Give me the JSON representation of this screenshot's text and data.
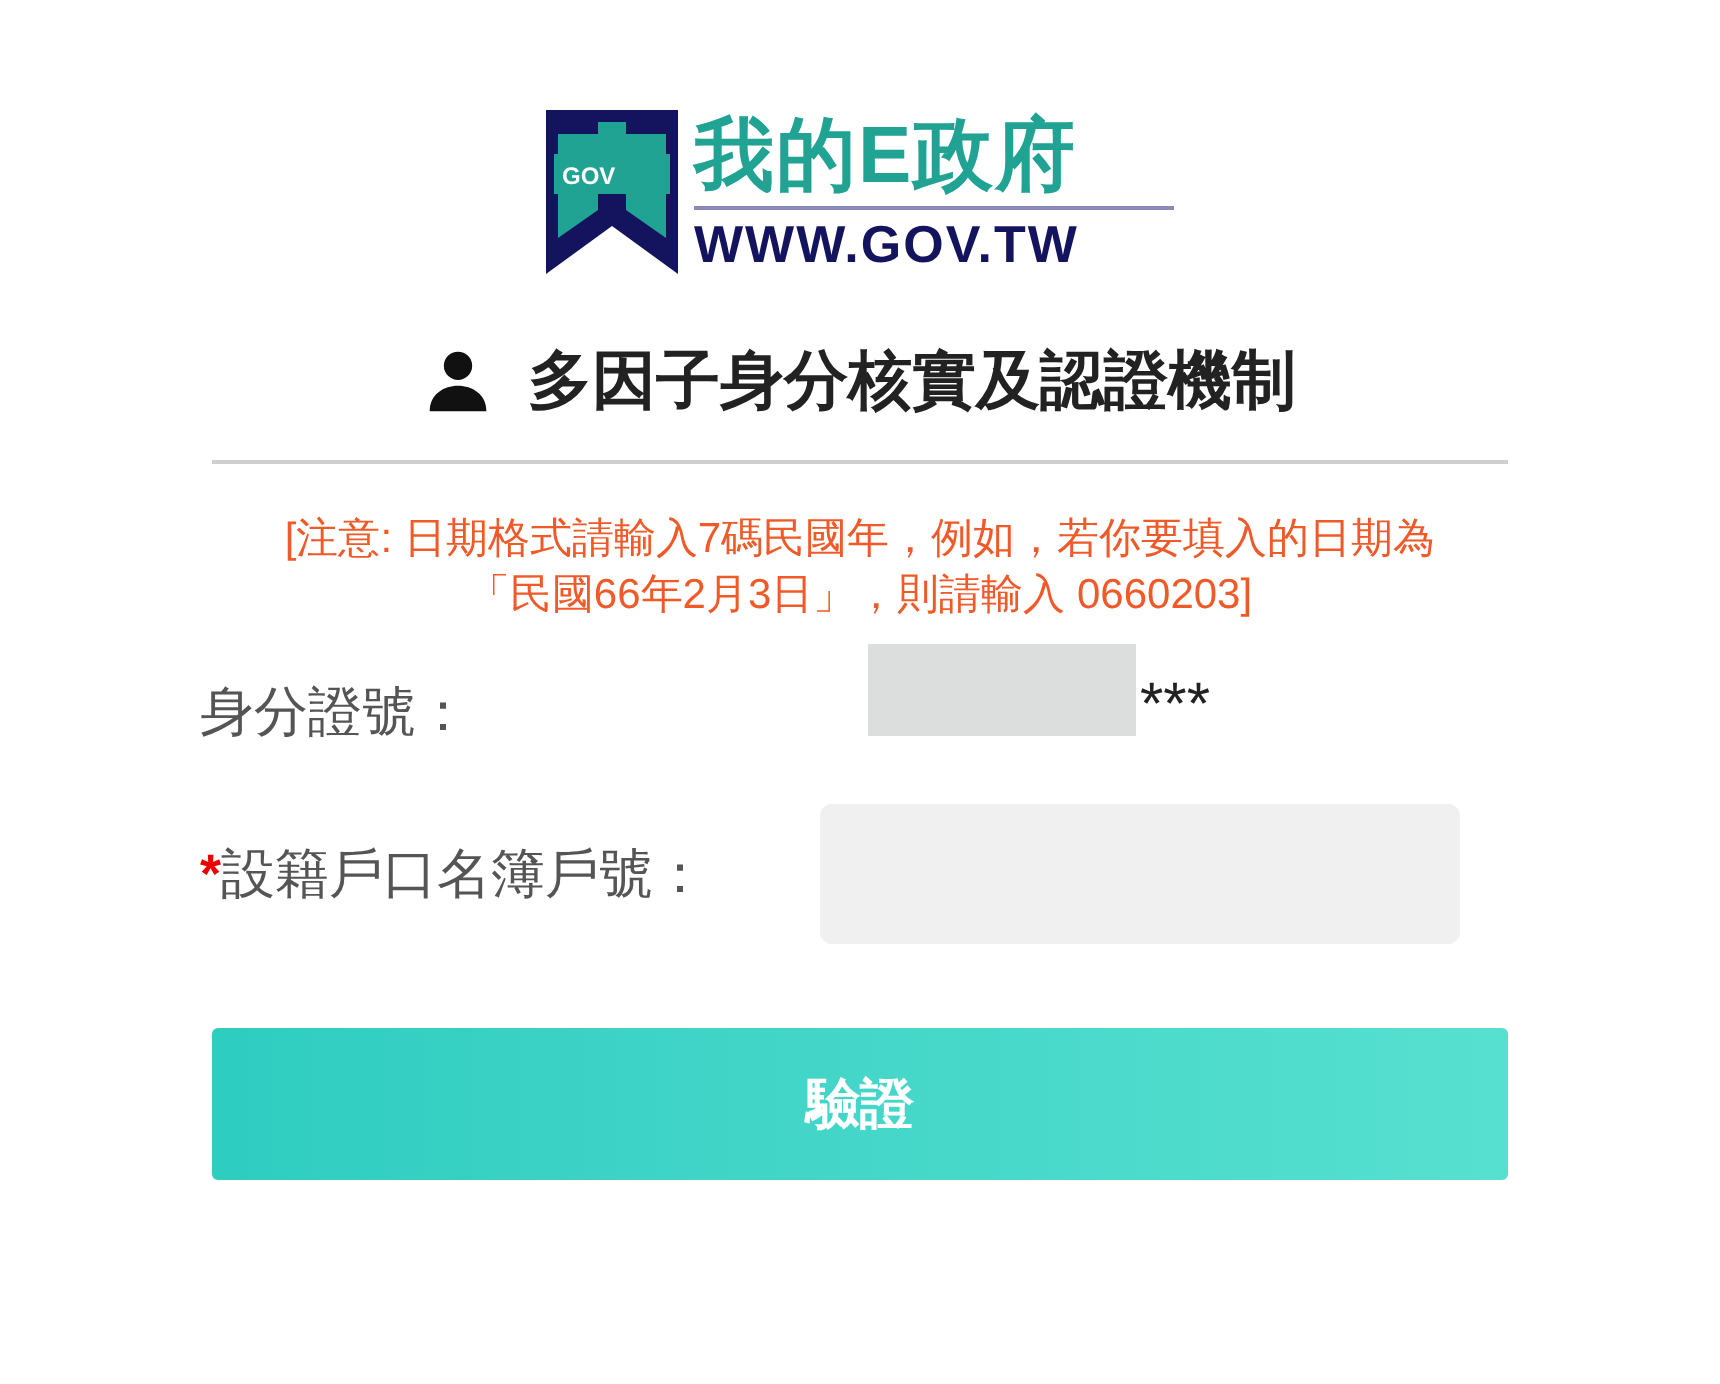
{
  "logo": {
    "badge": "GOV",
    "title": "我的E政府",
    "url": "WWW.GOV.TW"
  },
  "heading": "多因子身分核實及認證機制",
  "notice": "[注意: 日期格式請輸入7碼民國年，例如，若你要填入的日期為「民國66年2月3日」，則請輸入 0660203]",
  "fields": [
    {
      "label": "身分證號：",
      "required": false,
      "kind": "static",
      "value": "***",
      "redacted": true
    },
    {
      "label": "設籍戶口名簿戶號：",
      "required": true,
      "kind": "input"
    }
  ],
  "required_mark": "*",
  "submit_button": "驗證"
}
